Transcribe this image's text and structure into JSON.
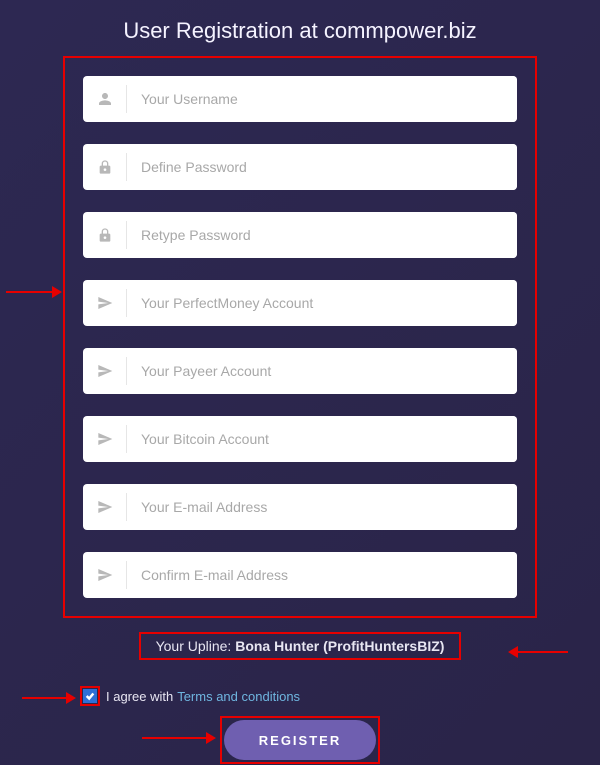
{
  "title": "User Registration at commpower.biz",
  "fields": [
    {
      "icon": "person",
      "placeholder": "Your Username"
    },
    {
      "icon": "lock",
      "placeholder": "Define Password"
    },
    {
      "icon": "lock",
      "placeholder": "Retype Password"
    },
    {
      "icon": "plane",
      "placeholder": "Your PerfectMoney Account"
    },
    {
      "icon": "plane",
      "placeholder": "Your Payeer Account"
    },
    {
      "icon": "plane",
      "placeholder": "Your Bitcoin Account"
    },
    {
      "icon": "plane",
      "placeholder": "Your E-mail Address"
    },
    {
      "icon": "plane",
      "placeholder": "Confirm E-mail Address"
    }
  ],
  "upline": {
    "label": "Your Upline: ",
    "name": "Bona Hunter (ProfitHuntersBIZ)"
  },
  "agree": {
    "text": "I agree with",
    "link": "Terms and conditions"
  },
  "register_label": "REGISTER",
  "colors": {
    "annotation": "#e60000",
    "accent": "#6f5fb0",
    "link": "#6fb6e0"
  }
}
